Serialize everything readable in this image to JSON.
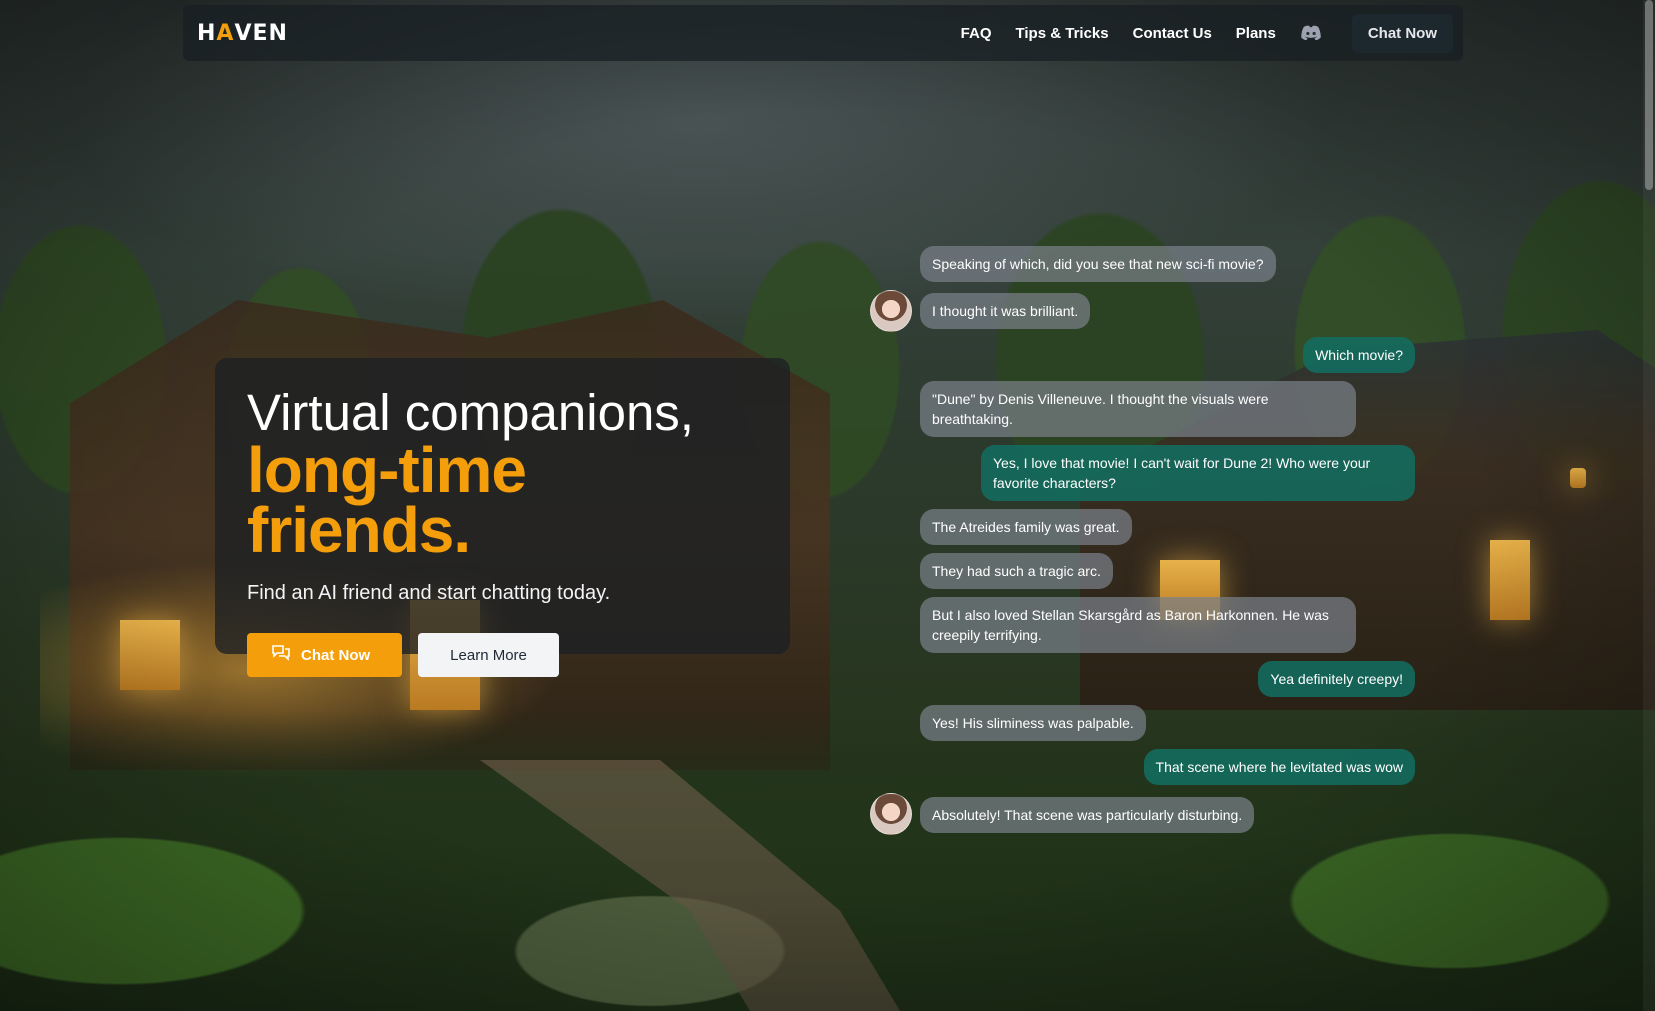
{
  "nav": {
    "logo": "HAVEN",
    "logo_prefix": "H",
    "logo_accent": "A",
    "logo_suffix": "VEN",
    "links": [
      "FAQ",
      "Tips & Tricks",
      "Contact Us",
      "Plans"
    ],
    "discord_icon": "discord-icon",
    "cta": "Chat Now"
  },
  "hero": {
    "title_line1": "Virtual companions,",
    "title_line2": "long-time friends.",
    "subtitle": "Find an AI friend and start chatting today.",
    "primary_button": "Chat Now",
    "primary_icon": "chat-bubbles-icon",
    "secondary_button": "Learn More"
  },
  "chat": {
    "messages": [
      {
        "from": "ai",
        "text": "Speaking of which, did you see that new sci-fi movie?"
      },
      {
        "from": "ai",
        "text": "I thought it was brilliant."
      },
      {
        "from": "user",
        "text": "Which movie?"
      },
      {
        "from": "ai",
        "text": "\"Dune\" by Denis Villeneuve. I thought the visuals were breathtaking."
      },
      {
        "from": "user",
        "text": "Yes, I love that movie! I can't wait for Dune 2! Who were your favorite characters?"
      },
      {
        "from": "ai",
        "text": "The Atreides family was great."
      },
      {
        "from": "ai",
        "text": "They had such a tragic arc."
      },
      {
        "from": "ai",
        "text": "But I also loved Stellan Skarsgård as Baron Harkonnen. He was creepily terrifying."
      },
      {
        "from": "user",
        "text": "Yea definitely creepy!"
      },
      {
        "from": "ai",
        "text": "Yes! His sliminess was palpable."
      },
      {
        "from": "user",
        "text": "That scene where he levitated was wow"
      },
      {
        "from": "ai",
        "text": "Absolutely! That scene was particularly disturbing."
      }
    ]
  },
  "colors": {
    "accent": "#f59e0b",
    "user_bubble": "#126e62",
    "ai_bubble": "#78808a"
  }
}
